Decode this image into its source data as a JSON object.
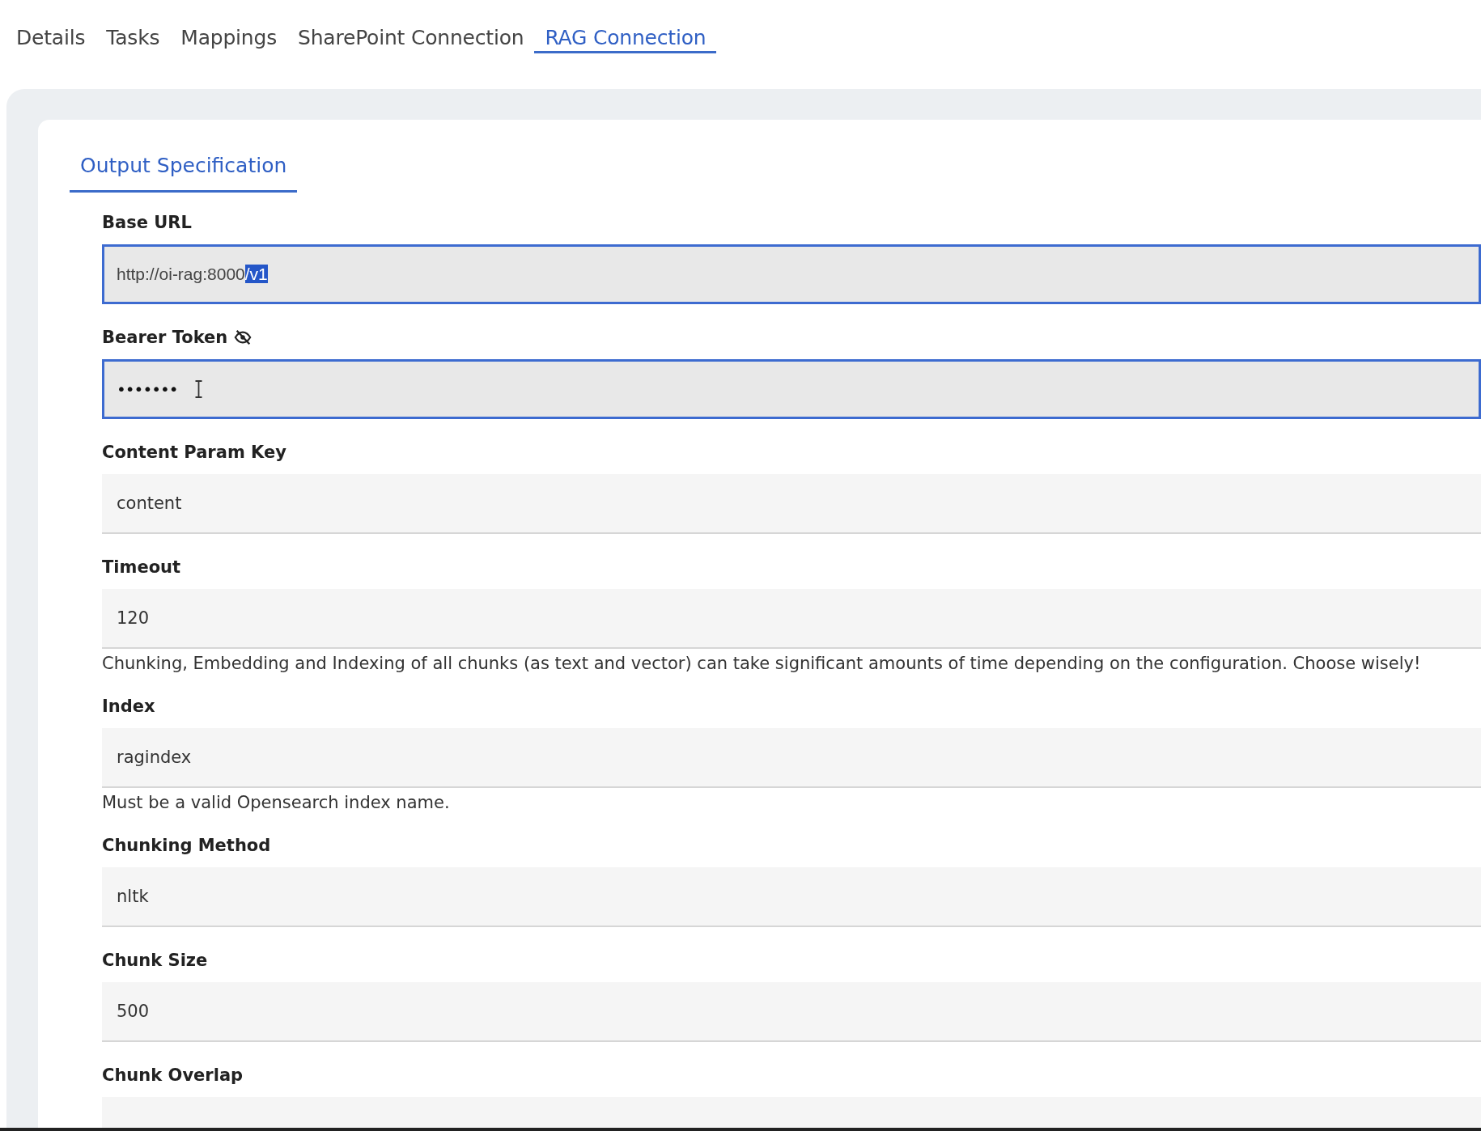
{
  "tabs": [
    {
      "label": "Details",
      "selected": false
    },
    {
      "label": "Tasks",
      "selected": false
    },
    {
      "label": "Mappings",
      "selected": false
    },
    {
      "label": "SharePoint Connection",
      "selected": false
    },
    {
      "label": "RAG Connection",
      "selected": true
    }
  ],
  "section_tabs": [
    {
      "label": "Output Specification",
      "selected": true
    }
  ],
  "fields": [
    {
      "kind": "url",
      "label": "Base URL",
      "value": "http://oi-rag:8000",
      "selected_value": "/v1",
      "focused": true
    },
    {
      "kind": "password",
      "label": "Bearer Token",
      "value": "•••••••",
      "focused": true
    },
    {
      "kind": "text",
      "label": "Content Param Key",
      "value": "content",
      "focused": false
    },
    {
      "kind": "text",
      "label": "Timeout",
      "value": "120",
      "focused": false,
      "help": "Chunking, Embedding and Indexing of all chunks (as text and vector) can take significant amounts of time depending on the configuration. Choose wisely!"
    },
    {
      "kind": "text",
      "label": "Index",
      "value": "ragindex",
      "focused": false,
      "help": "Must be a valid Opensearch index name."
    },
    {
      "kind": "text",
      "label": "Chunking Method",
      "value": "nltk",
      "focused": false
    },
    {
      "kind": "text",
      "label": "Chunk Size",
      "value": "500",
      "focused": false
    },
    {
      "kind": "text",
      "label": "Chunk Overlap",
      "focused": false
    }
  ]
}
